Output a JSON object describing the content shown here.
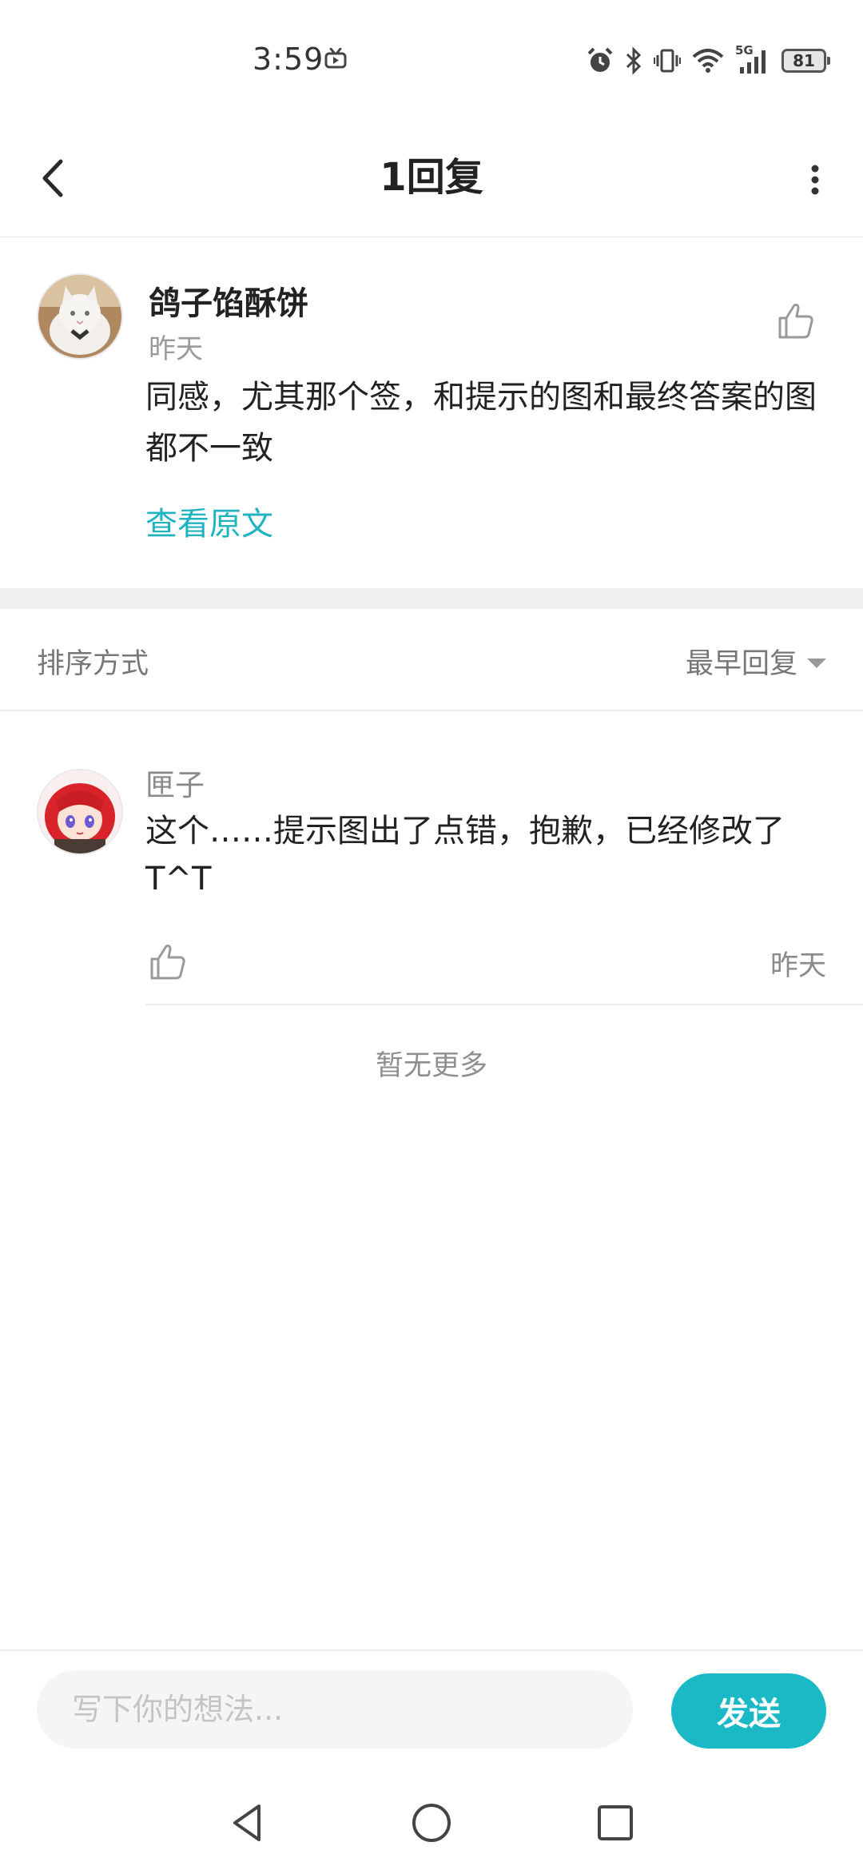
{
  "status_bar": {
    "time": "3:59",
    "network": "5G",
    "battery": "81"
  },
  "header": {
    "title": "1回复"
  },
  "original_comment": {
    "author": "鸽子馅酥饼",
    "time": "昨天",
    "content": "同感，尤其那个签，和提示的图和最终答案的图都不一致",
    "view_original": "查看原文"
  },
  "sort": {
    "label": "排序方式",
    "selected": "最早回复"
  },
  "replies": [
    {
      "author": "匣子",
      "content": "这个……提示图出了点错，抱歉，已经修改了T^T",
      "time": "昨天"
    }
  ],
  "list_end": "暂无更多",
  "composer": {
    "placeholder": "写下你的想法...",
    "send_label": "发送"
  },
  "colors": {
    "accent": "#1bb8c6",
    "link": "#22b3c1"
  }
}
